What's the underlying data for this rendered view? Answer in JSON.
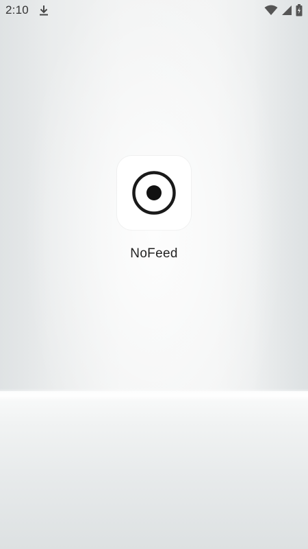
{
  "status_bar": {
    "time": "2:10",
    "icons": [
      "download-icon",
      "wifi-icon",
      "signal-icon",
      "battery-icon"
    ]
  },
  "launcher": {
    "apps": [
      {
        "label": "NoFeed",
        "icon": "target-circle-icon"
      }
    ]
  },
  "colors": {
    "icon_background": "#ffffff",
    "icon_ring": "#1a1a1a",
    "label_text": "#222222",
    "status_text": "#333333"
  }
}
